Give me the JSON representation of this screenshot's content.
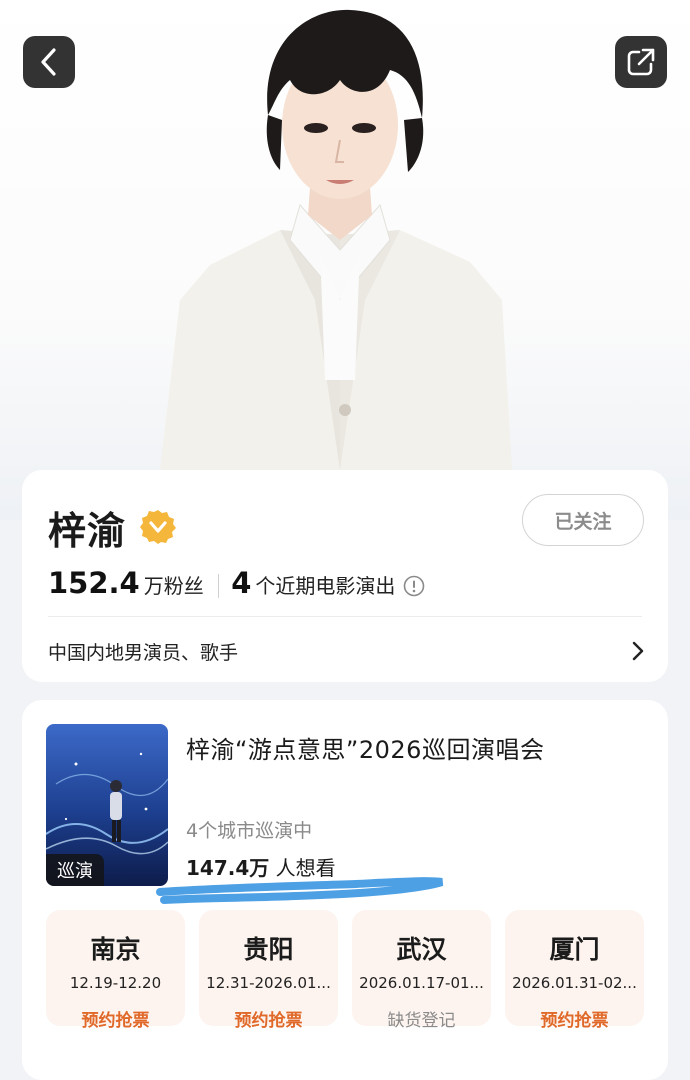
{
  "profile": {
    "name": "梓渝",
    "followers_num": "152.4",
    "followers_unit": "万粉丝",
    "shows_num": "4",
    "shows_unit": "个近期电影演出",
    "bio": "中国内地男演员、歌手",
    "follow_label": "已关注"
  },
  "concert": {
    "title": "梓渝“游点意思”2026巡回演唱会",
    "tag": "巡演",
    "subtitle": "4个城市巡演中",
    "want_num": "147.4万",
    "want_unit": " 人想看",
    "cities": [
      {
        "name": "南京",
        "date": "12.19-12.20",
        "action": "预约抢票",
        "action_type": "orange"
      },
      {
        "name": "贵阳",
        "date": "12.31-2026.01...",
        "action": "预约抢票",
        "action_type": "orange"
      },
      {
        "name": "武汉",
        "date": "2026.01.17-01...",
        "action": "缺货登记",
        "action_type": "gray"
      },
      {
        "name": "厦门",
        "date": "2026.01.31-02...",
        "action": "预约抢票",
        "action_type": "orange"
      }
    ]
  },
  "colors": {
    "accent": "#e0692a",
    "verified": "#f4b63b",
    "highlight": "#2f8fe0"
  },
  "icons": {
    "back": "chevron-left-icon",
    "share": "share-icon",
    "verified": "verified-badge-icon",
    "info": "info-circle-icon",
    "arrow": "chevron-right-icon"
  }
}
